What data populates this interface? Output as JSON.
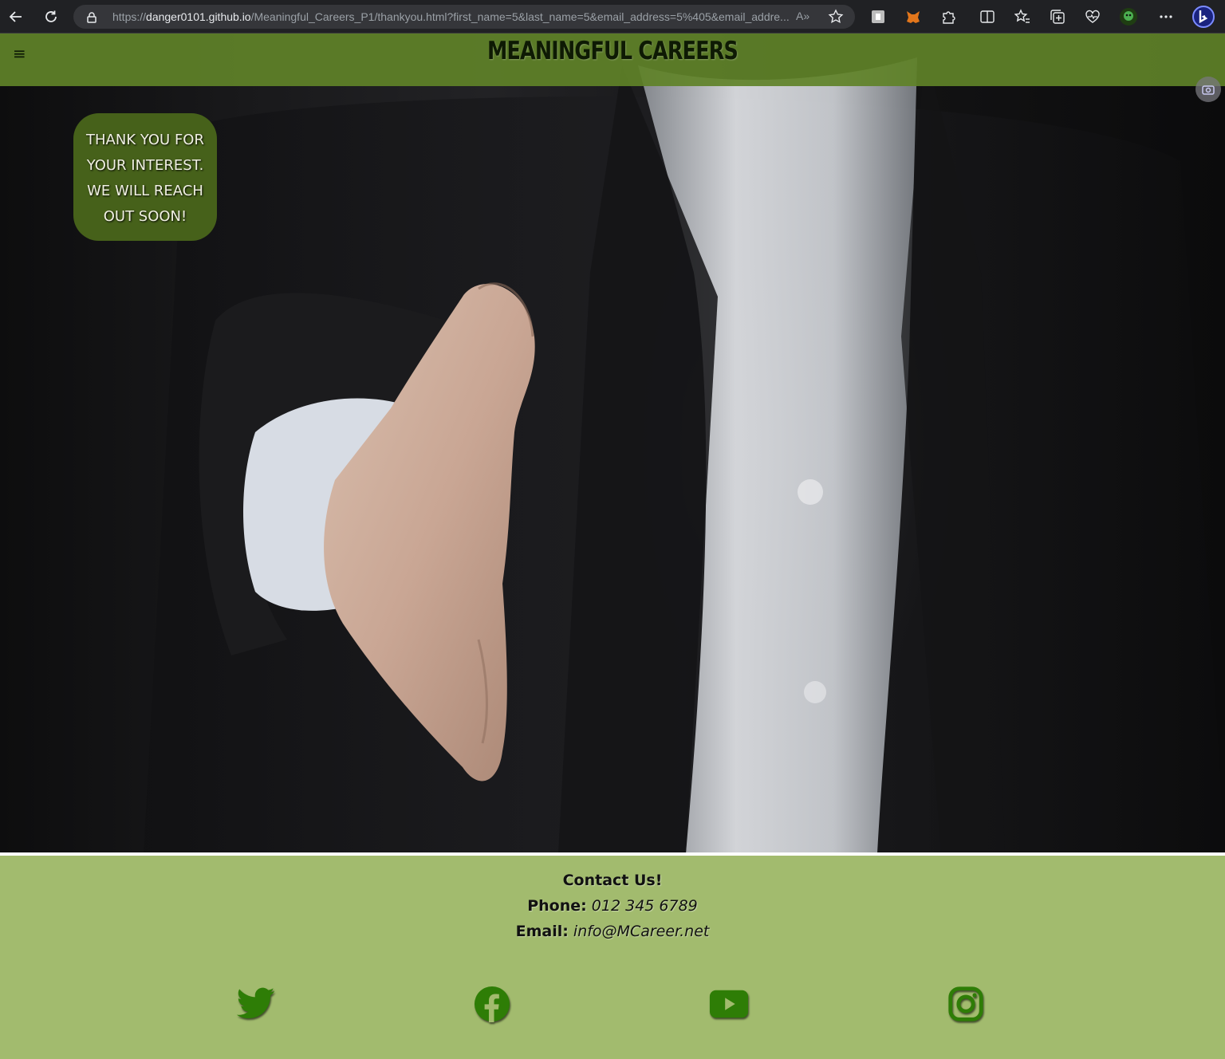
{
  "browser": {
    "url_prefix": "https://",
    "url_host": "danger0101.github.io",
    "url_rest": "/Meaningful_Careers_P1/thankyou.html?first_name=5&last_name=5&email_address=5%405&email_addre...",
    "read_aloud": "A»"
  },
  "site": {
    "brand": "MEANINGFUL CAREERS",
    "menu_glyph": "≡"
  },
  "hero": {
    "thanks_message": "THANK YOU FOR YOUR INTEREST. WE WILL REACH OUT SOON!"
  },
  "footer": {
    "title": "Contact Us!",
    "phone_label": "Phone:",
    "phone_value": "012 345 6789",
    "email_label": "Email:",
    "email_value": "info@MCareer.net"
  },
  "social": [
    {
      "icon": "twitter-icon"
    },
    {
      "icon": "facebook-icon"
    },
    {
      "icon": "youtube-icon"
    },
    {
      "icon": "instagram-icon"
    }
  ],
  "colors": {
    "header_green": "#5f8228",
    "card_green": "#46611a",
    "footer_green": "#a2bb6e",
    "icon_green": "#2e7d06"
  }
}
